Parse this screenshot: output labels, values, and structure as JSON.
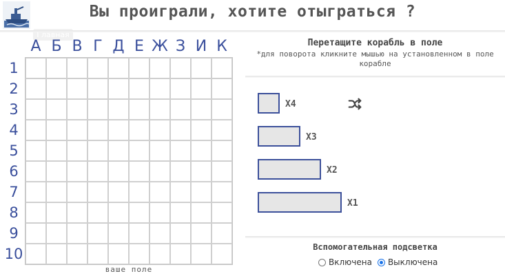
{
  "header": {
    "title": "Вы проиграли, хотите отыграться ?",
    "logo_icon": "warship-logo-icon",
    "hidden_button_label": "Главная"
  },
  "board": {
    "columns": [
      "А",
      "Б",
      "В",
      "Г",
      "Д",
      "Е",
      "Ж",
      "З",
      "И",
      "К"
    ],
    "rows": [
      "1",
      "2",
      "3",
      "4",
      "5",
      "6",
      "7",
      "8",
      "9",
      "10"
    ],
    "caption": "ваше поле"
  },
  "panel": {
    "title": "Перетащите корабль в поле",
    "hint": "*для поворота кликните мышью на установленном в поле корабле",
    "ships": [
      {
        "label": "X4",
        "size": 1
      },
      {
        "label": "X3",
        "size": 2
      },
      {
        "label": "X2",
        "size": 3
      },
      {
        "label": "X1",
        "size": 4
      }
    ],
    "shuffle_icon": "shuffle-icon"
  },
  "highlight": {
    "title": "Вспомогательная подсветка",
    "options": [
      {
        "label": "Включена",
        "selected": false
      },
      {
        "label": "Выключена",
        "selected": true
      }
    ]
  },
  "colors": {
    "accent": "#3b4f9a",
    "ship_fill": "#e6e6e6",
    "radio_active": "#1a73e8"
  }
}
